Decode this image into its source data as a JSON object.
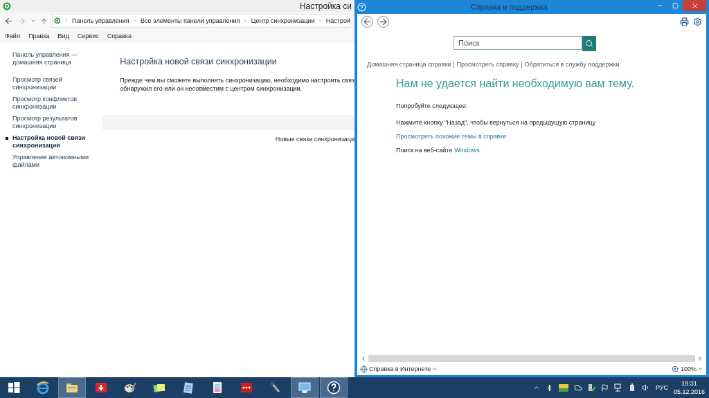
{
  "explorer": {
    "title": "Настройка си",
    "address": [
      "Панель управления",
      "Все элементы панели управления",
      "Центр синхронизации",
      "Настрой"
    ],
    "menu": [
      "Файл",
      "Правка",
      "Вид",
      "Сервис",
      "Справка"
    ],
    "sidebar": {
      "items": [
        {
          "label": "Панель управления — домашняя страница",
          "selected": false
        },
        {
          "label": "Просмотр связей синхронизации",
          "selected": false
        },
        {
          "label": "Просмотр конфликтов синхронизации",
          "selected": false
        },
        {
          "label": "Просмотр результатов синхронизации",
          "selected": false
        },
        {
          "label": "Настройка новой связи синхронизации",
          "selected": true
        },
        {
          "label": "Управление автономными файлами",
          "selected": false
        }
      ]
    },
    "heading": "Настройка новой связи синхронизации",
    "description": [
      "Прежде чем вы сможете выполнять синхронизацию, необходимо настроить связ",
      "обнаружил его или он несовместим с центром синхронизации."
    ],
    "band_label": "Новые связи синхронизаци"
  },
  "help": {
    "title": "Справка и поддержка",
    "search": {
      "placeholder": "Поиск"
    },
    "links": [
      "Домашняя страница справки",
      "Просмотреть справку",
      "Обратиться в службу поддержки"
    ],
    "link_separator": "|",
    "heading": "Нам не удается найти необходимую вам тему.",
    "intro": "Попробуйте следующее:",
    "suggestions": [
      {
        "kind": "text",
        "text": "Нажмите кнопку \"Назад\", чтобы вернуться на предыдущую страницу"
      },
      {
        "kind": "link",
        "text": "Просмотреть похожие темы в справке"
      },
      {
        "kind": "mixed",
        "text": "Поиск на веб-сайте",
        "link": "Windows"
      }
    ],
    "status": {
      "label": "Справка в Интернете",
      "zoom": "100%"
    }
  },
  "taskbar": {
    "apps": [
      {
        "kind": "start",
        "selected": false
      },
      {
        "kind": "browser",
        "selected": false
      },
      {
        "kind": "folder",
        "selected": true
      },
      {
        "kind": "download",
        "selected": false
      },
      {
        "kind": "paint",
        "selected": false
      },
      {
        "kind": "notes",
        "selected": false
      },
      {
        "kind": "notepad",
        "selected": false
      },
      {
        "kind": "document",
        "selected": false
      },
      {
        "kind": "redapp",
        "selected": false
      },
      {
        "kind": "microphone",
        "selected": false
      },
      {
        "kind": "remote",
        "selected": true
      },
      {
        "kind": "help",
        "selected": true
      }
    ],
    "tray": {
      "language": "РУС",
      "time": "19:31",
      "date": "05.12.2016"
    }
  }
}
